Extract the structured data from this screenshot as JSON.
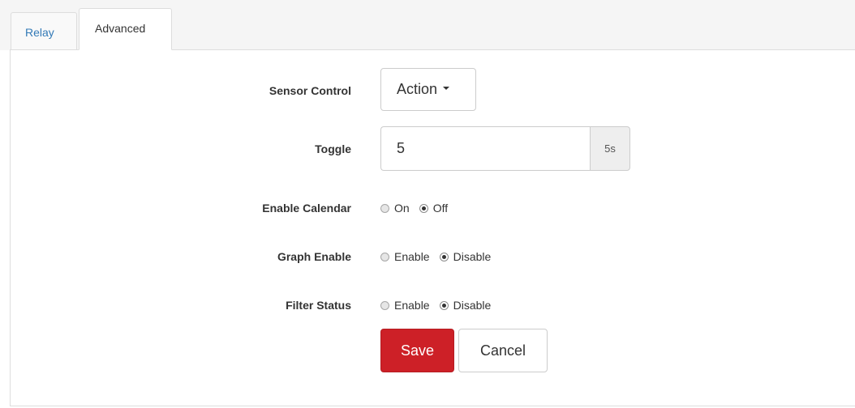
{
  "tabs": [
    {
      "label": "Relay",
      "active": false
    },
    {
      "label": "Advanced",
      "active": true
    }
  ],
  "form": {
    "sensor_control": {
      "label": "Sensor Control",
      "button_label": "Action"
    },
    "toggle": {
      "label": "Toggle",
      "value": "5",
      "unit": "5s"
    },
    "enable_calendar": {
      "label": "Enable Calendar",
      "options": [
        "On",
        "Off"
      ],
      "selected": "Off"
    },
    "graph_enable": {
      "label": "Graph Enable",
      "options": [
        "Enable",
        "Disable"
      ],
      "selected": "Disable"
    },
    "filter_status": {
      "label": "Filter Status",
      "options": [
        "Enable",
        "Disable"
      ],
      "selected": "Disable"
    }
  },
  "actions": {
    "save_label": "Save",
    "cancel_label": "Cancel"
  },
  "colors": {
    "save": "#cd2027",
    "link": "#337ab7"
  }
}
